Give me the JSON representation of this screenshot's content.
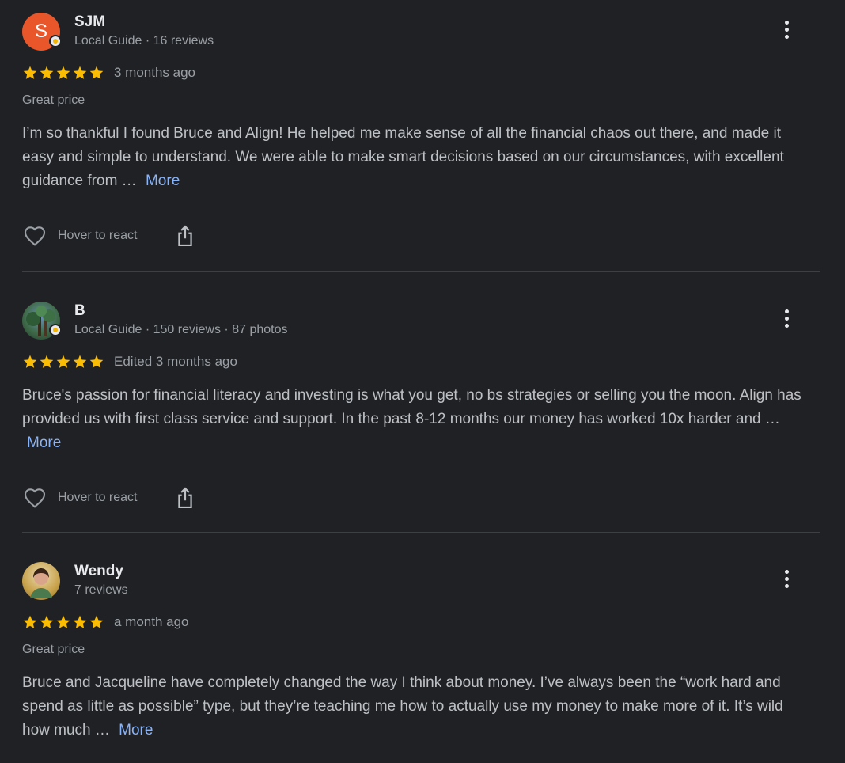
{
  "reviews": [
    {
      "name": "SJM",
      "avatar_letter": "S",
      "avatar_color": "#e8562a",
      "meta": "Local Guide · 16 reviews",
      "rating": 5,
      "when": "3 months ago",
      "tag": "Great price",
      "text": "I’m so thankful I found Bruce and Align! He helped me make sense of all the financial chaos out there, and made it easy and simple to understand. We were able to make smart decisions based on our circumstances, with excellent guidance from … ",
      "more": "More",
      "react_label": "Hover to react"
    },
    {
      "name": "B",
      "avatar_letter": "",
      "avatar_color": "#3f6b4a",
      "meta": "Local Guide · 150 reviews · 87 photos",
      "rating": 5,
      "when": "Edited 3 months ago",
      "text": "Bruce's passion for financial literacy and investing is what you get, no bs strategies or selling you the moon. Align has provided us with first class service and support. In the past 8-12 months our money has worked 10x harder and … ",
      "more": "More",
      "react_label": "Hover to react"
    },
    {
      "name": "Wendy",
      "avatar_letter": "",
      "avatar_color": "#c8a24a",
      "meta": "7 reviews",
      "rating": 5,
      "when": "a month ago",
      "tag": "Great price",
      "text": "Bruce and Jacqueline have completely changed the way I think about money. I’ve always been the “work hard and spend as little as possible” type, but they’re teaching me how to actually use my money to make more of it. It’s wild how much … ",
      "more": "More"
    }
  ],
  "colors": {
    "background": "#202124",
    "star": "#fbbc04",
    "link": "#8ab4f8",
    "divider": "#3c4043"
  }
}
